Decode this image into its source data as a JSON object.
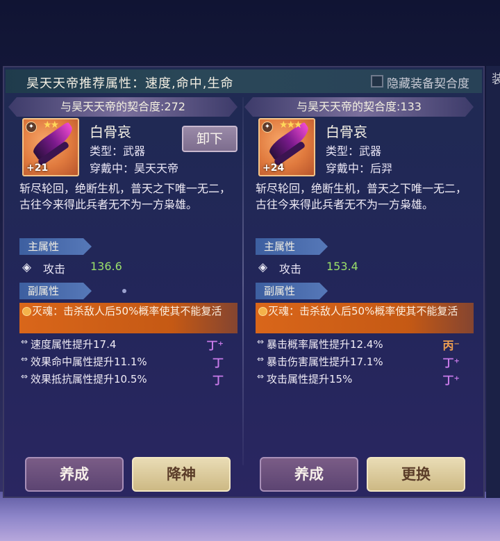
{
  "header": {
    "title": "昊天天帝推荐属性：速度,命中,生命",
    "hide_label": "隐藏装备契合度",
    "right_stub": "装"
  },
  "left": {
    "compat": "与昊天天帝的契合度:272",
    "plus": "+21",
    "name": "白骨哀",
    "type": "类型：武器",
    "worn": "穿戴中：昊天天帝",
    "unequip": "卸下",
    "desc": "斩尽轮回，绝断生机，普天之下唯一无二，古往今来得此兵者无不为一方枭雄。",
    "main_tag": "主属性",
    "atk_label": "攻击",
    "atk_value": "136.6",
    "sub_tag": "副属性",
    "soul": "灭魂：击杀敌人后50%概率使其不能复活",
    "subs": [
      {
        "text": "速度属性提升17.4",
        "grade": "丁⁺"
      },
      {
        "text": "效果命中属性提升11.1%",
        "grade": "丁"
      },
      {
        "text": "效果抵抗属性提升10.5%",
        "grade": "丁"
      }
    ],
    "btn1": "养成",
    "btn2": "降神"
  },
  "right": {
    "compat": "与昊天天帝的契合度:133",
    "plus": "+24",
    "name": "白骨哀",
    "type": "类型：武器",
    "worn": "穿戴中：后羿",
    "desc": "斩尽轮回，绝断生机，普天之下唯一无二，古往今来得此兵者无不为一方枭雄。",
    "main_tag": "主属性",
    "atk_label": "攻击",
    "atk_value": "153.4",
    "sub_tag": "副属性",
    "soul": "灭魂：击杀敌人后50%概率使其不能复活",
    "subs": [
      {
        "text": "暴击概率属性提升12.4%",
        "grade": "丙⁻"
      },
      {
        "text": "暴击伤害属性提升17.1%",
        "grade": "丁⁺"
      },
      {
        "text": "攻击属性提升15%",
        "grade": "丁⁺"
      }
    ],
    "btn1": "养成",
    "btn2": "更换"
  },
  "colors": {
    "accent_green": "#9be06a",
    "soul_orange": "#d9661a",
    "grade_purple": "#c77ae8",
    "grade_orange": "#f0a050"
  },
  "icons": [
    "weapon-icon",
    "attack-icon",
    "soul-icon",
    "arrow-icon"
  ]
}
